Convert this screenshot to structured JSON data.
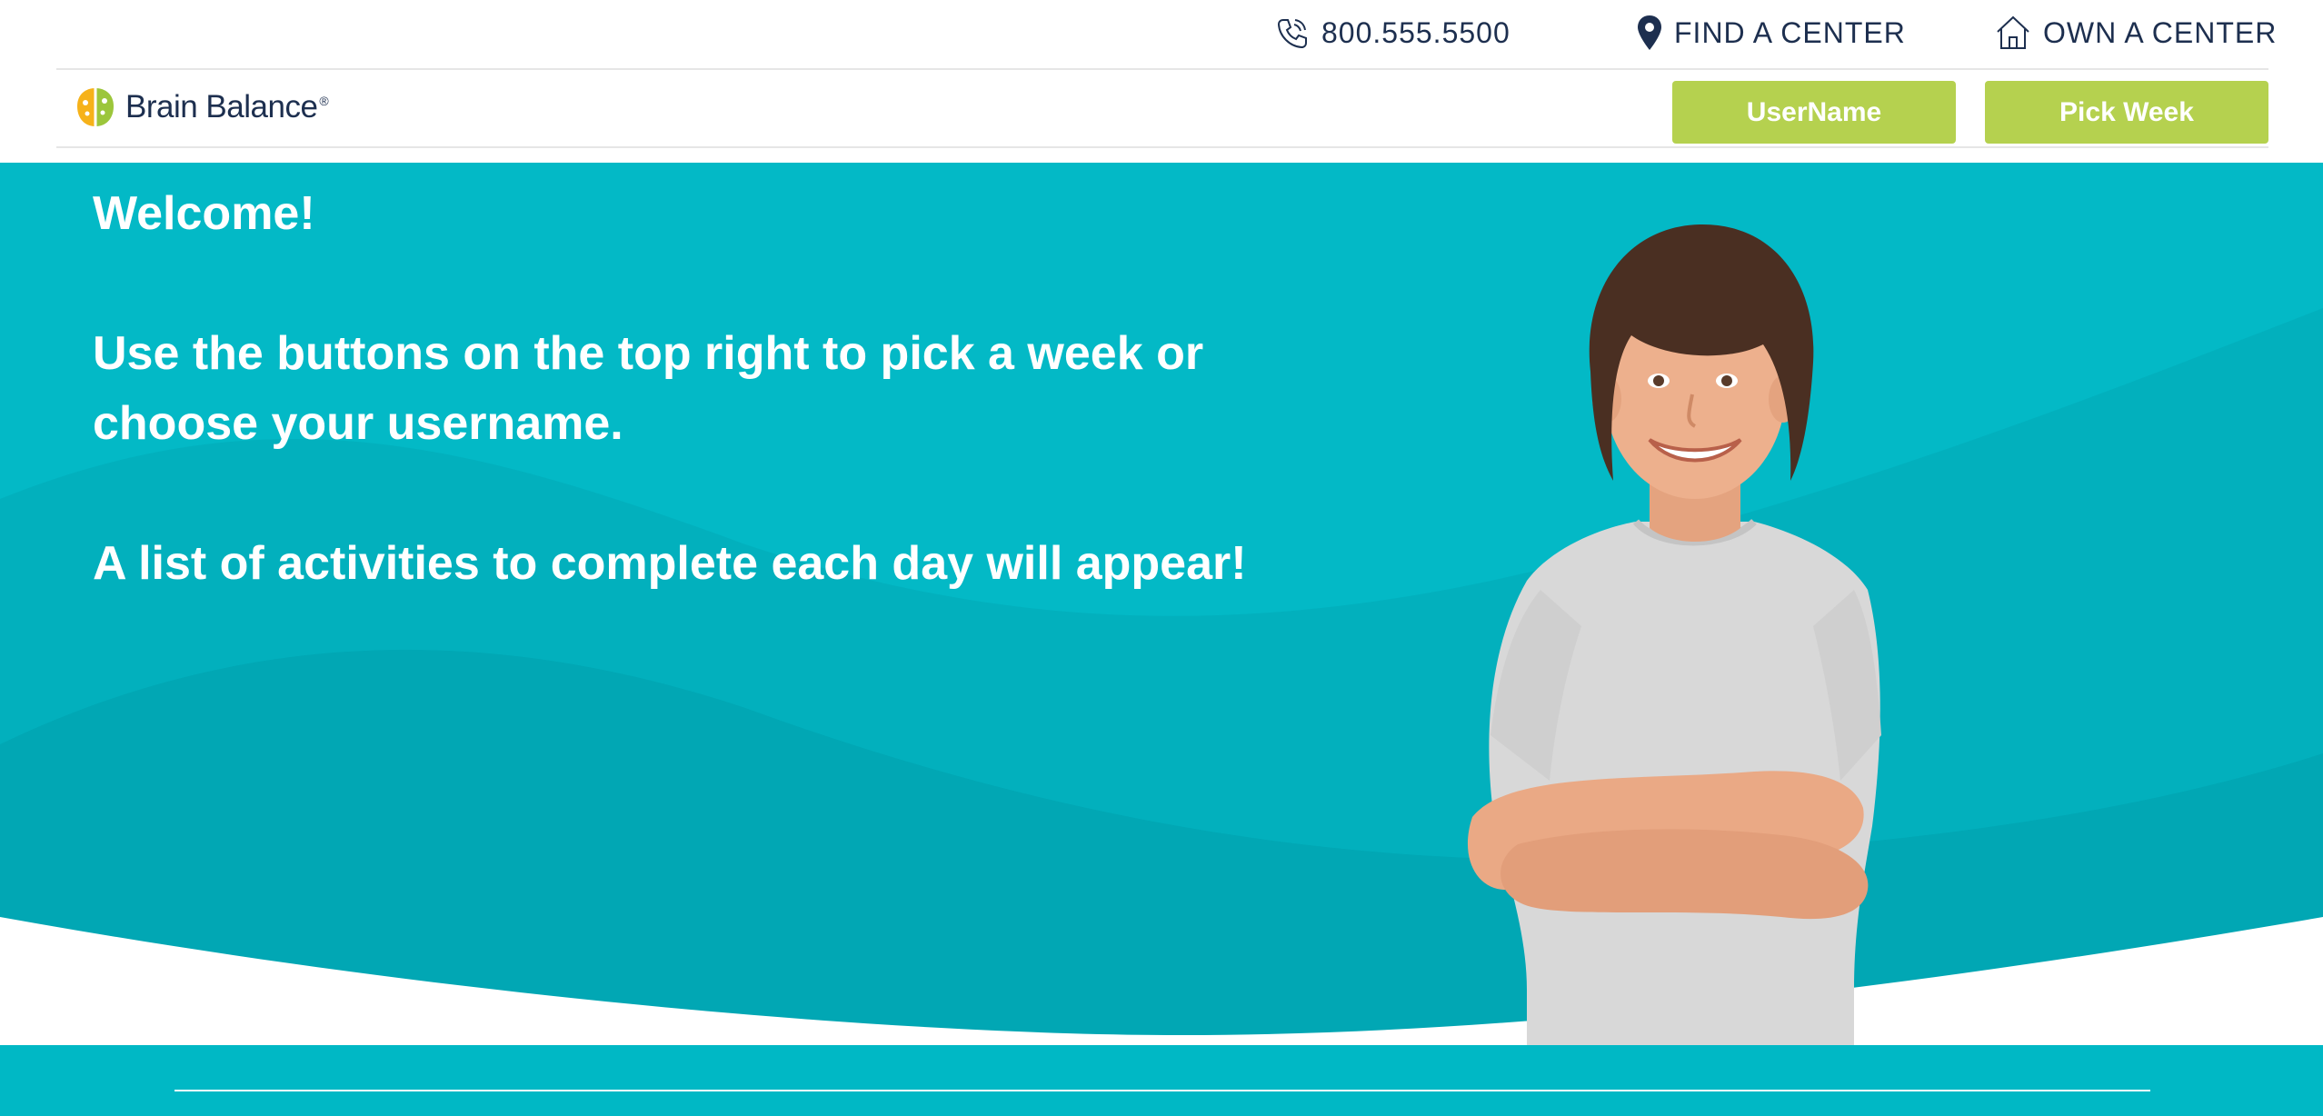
{
  "utility": {
    "phone": "800.555.5500",
    "find_center": "FIND A CENTER",
    "own_center": "OWN A CENTER"
  },
  "brand": {
    "name": "Brain Balance",
    "reg": "®"
  },
  "nav": {
    "username_label": "UserName",
    "pick_week_label": "Pick Week"
  },
  "hero": {
    "heading": "Welcome!",
    "line1": "Use the buttons on the top right to pick a week or choose your username.",
    "line2": "A list of activities to complete each day will appear!"
  },
  "icons": {
    "phone": "phone-icon",
    "location": "map-pin-icon",
    "home": "house-icon",
    "logo": "brain-logo-icon"
  },
  "colors": {
    "navy": "#1d2f4f",
    "teal": "#00b8c5",
    "lime": "#b5d14f",
    "white": "#ffffff"
  }
}
